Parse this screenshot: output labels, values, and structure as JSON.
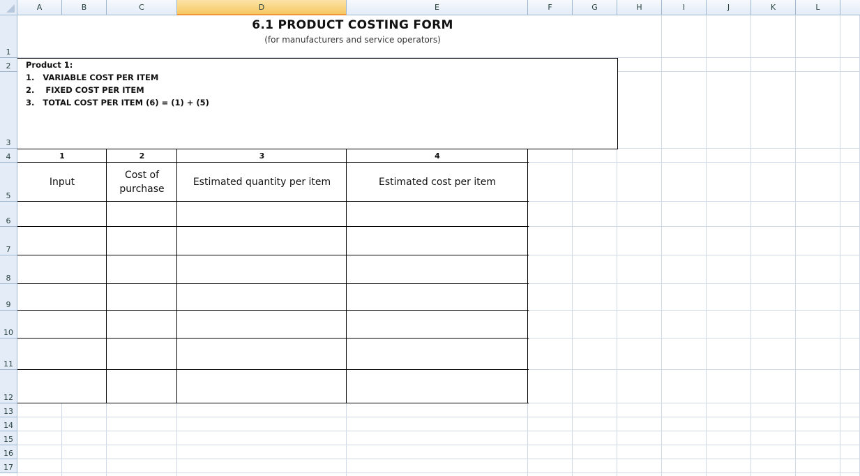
{
  "spreadsheet": {
    "columns": [
      "A",
      "B",
      "C",
      "D",
      "E",
      "F",
      "G",
      "H",
      "I",
      "J",
      "K",
      "L"
    ],
    "selected_column": "D",
    "rows": [
      "1",
      "2",
      "3",
      "4",
      "5",
      "6",
      "7",
      "8",
      "9",
      "10",
      "11",
      "12",
      "13",
      "14",
      "15",
      "16",
      "17"
    ]
  },
  "form": {
    "title": "6.1 PRODUCT COSTING FORM",
    "subtitle": "(for manufacturers and service operators)",
    "product_label": "Product 1:",
    "items": [
      "1.   VARIABLE COST PER ITEM",
      "2.    FIXED COST PER ITEM",
      "3.   TOTAL COST PER ITEM (6) = (1) + (5)"
    ],
    "column_numbers": [
      "1",
      "2",
      "3",
      "4"
    ],
    "column_headers": [
      "Input",
      "Cost of purchase",
      "Estimated quantity per item",
      "Estimated cost per item"
    ]
  }
}
